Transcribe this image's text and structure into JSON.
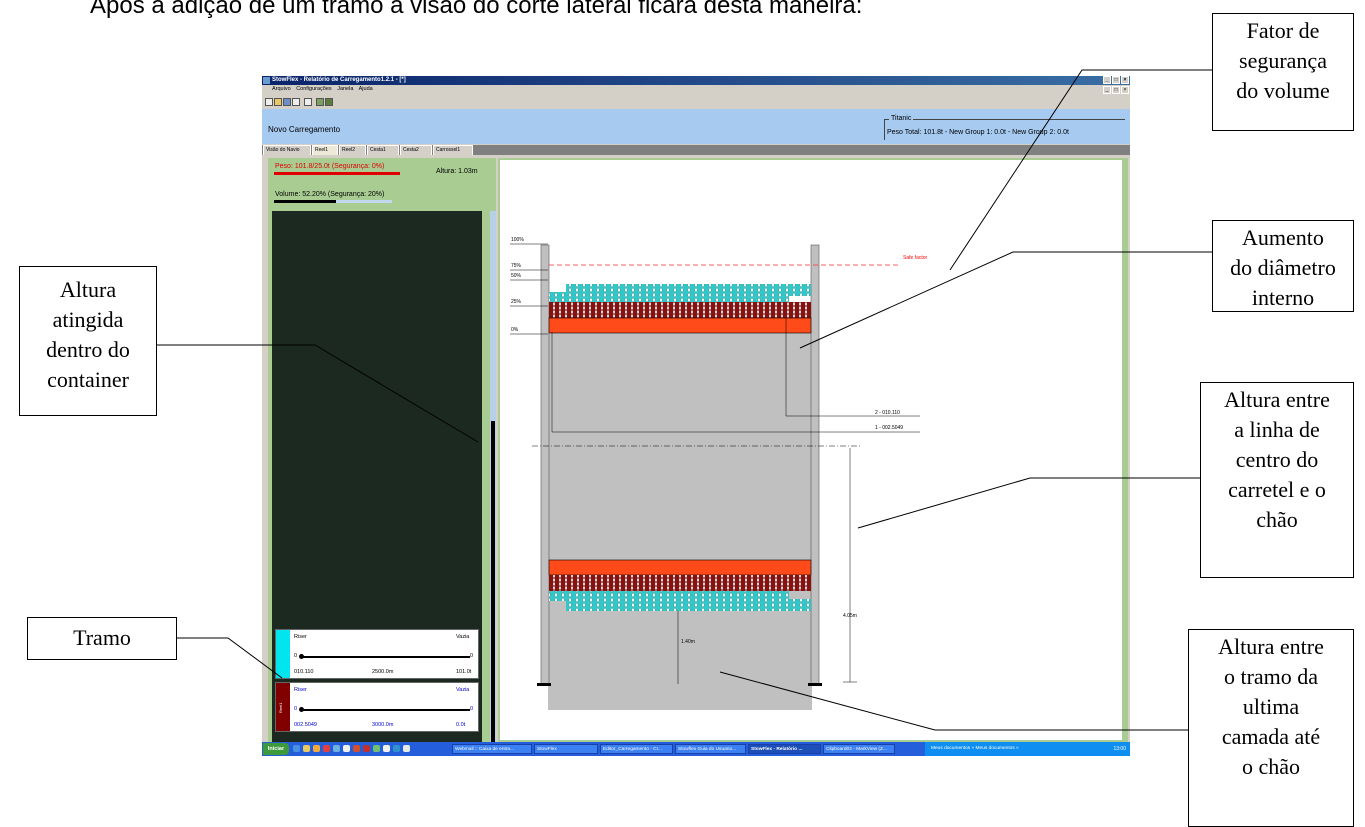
{
  "heading": "Após a adição de um tramo a visão do corte lateral ficará desta maneira:",
  "callouts": {
    "safety_factor": "Fator de\nsegurança\ndo volume",
    "inner_diameter": "Aumento\ndo diâmetro\ninterno",
    "height_reached": "Altura\natingida\ndentro do\ncontainer",
    "center_height": "Altura entre\na linha de\ncentro do\ncarretel e o\nchão",
    "span": "Tramo",
    "layer_height": "Altura entre\no tramo da\nultima\ncamada até\no chão"
  },
  "app": {
    "title": "StowFlex - Relatório de Carregamento1.2.1 - [*]",
    "menu": [
      "Arquivo",
      "Configurações",
      "Janela",
      "Ajuda"
    ],
    "document_title": "Novo Carregamento",
    "ship": {
      "name": "Titanic",
      "stats": "Peso Total: 101.8t   - New Group 1: 0.0t   - New Group 2: 0.0t"
    },
    "tabs": [
      "Visão do Navio",
      "Reel1",
      "Reel2",
      "Cesta1",
      "Cesta2",
      "Carrossel1"
    ],
    "left": {
      "weight": "Peso: 101.8/25.0t (Segurança: 0%)",
      "height": "Altura: 1.03m",
      "volume": "Volume: 52.20% (Segurança: 20%)",
      "volume_fraction": 0.522,
      "spans": [
        {
          "type": "Riser",
          "dest": "Vazia",
          "from": "0",
          "to": "0",
          "id": "010.110",
          "length": "2500.0m",
          "weight": "101.0t",
          "color": "#00e5ee",
          "text_color": "#000000",
          "strip_label": ""
        },
        {
          "type": "Riser",
          "dest": "Vazia",
          "from": "0",
          "to": "0",
          "id": "002.5049",
          "length": "3000.0m",
          "weight": "0.0t",
          "color": "#800000",
          "text_color": "#0000cc",
          "strip_label": "Reel1"
        }
      ]
    },
    "canvas": {
      "percent_labels": [
        "100%",
        "75%",
        "50%",
        "25%",
        "0%"
      ],
      "safe_factor": "Safe factor",
      "span_tags": [
        "2 - 010.110",
        "1 - 002.5049"
      ],
      "center_height": "4.05m",
      "last_layer_height": "1.40m"
    },
    "taskbar": {
      "start": "Iniciar",
      "tasks": [
        "Webmail :: Caixa de entra...",
        "StowFlex",
        "Editor_Carregamento - Cr...",
        "Stowflex Guia do Usuario...",
        "StowFlex - Relatório ...",
        "Clipboard02 - MarkView (Z..."
      ],
      "tray": "Meus documentos  »  Meus documentos  »",
      "clock": "13:00"
    }
  }
}
